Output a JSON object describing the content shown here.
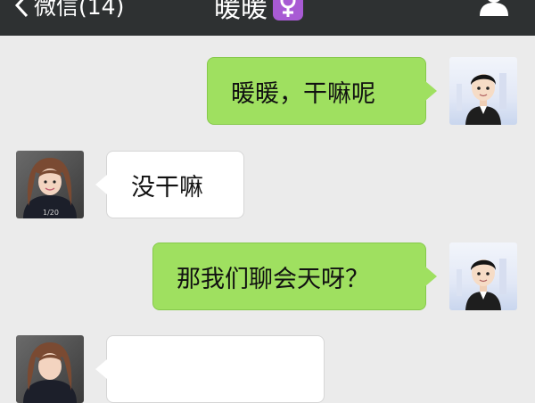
{
  "header": {
    "back_label": "微信(14)",
    "title": "暖暖",
    "gender_icon": "female-symbol-icon",
    "gender_badge_color": "#a85ad4",
    "contact_icon": "person-icon"
  },
  "colors": {
    "header_bg": "#2e3132",
    "chat_bg": "#ebebeb",
    "outgoing_bubble": "#9fe060",
    "incoming_bubble": "#ffffff"
  },
  "messages": [
    {
      "direction": "outgoing",
      "text": "暖暖，干嘛呢",
      "avatar": "self-avatar"
    },
    {
      "direction": "incoming",
      "text": "没干嘛",
      "avatar": "contact-avatar"
    },
    {
      "direction": "outgoing",
      "text": "那我们聊会天呀？",
      "avatar": "self-avatar"
    },
    {
      "direction": "incoming",
      "text": "",
      "avatar": "contact-avatar"
    }
  ]
}
